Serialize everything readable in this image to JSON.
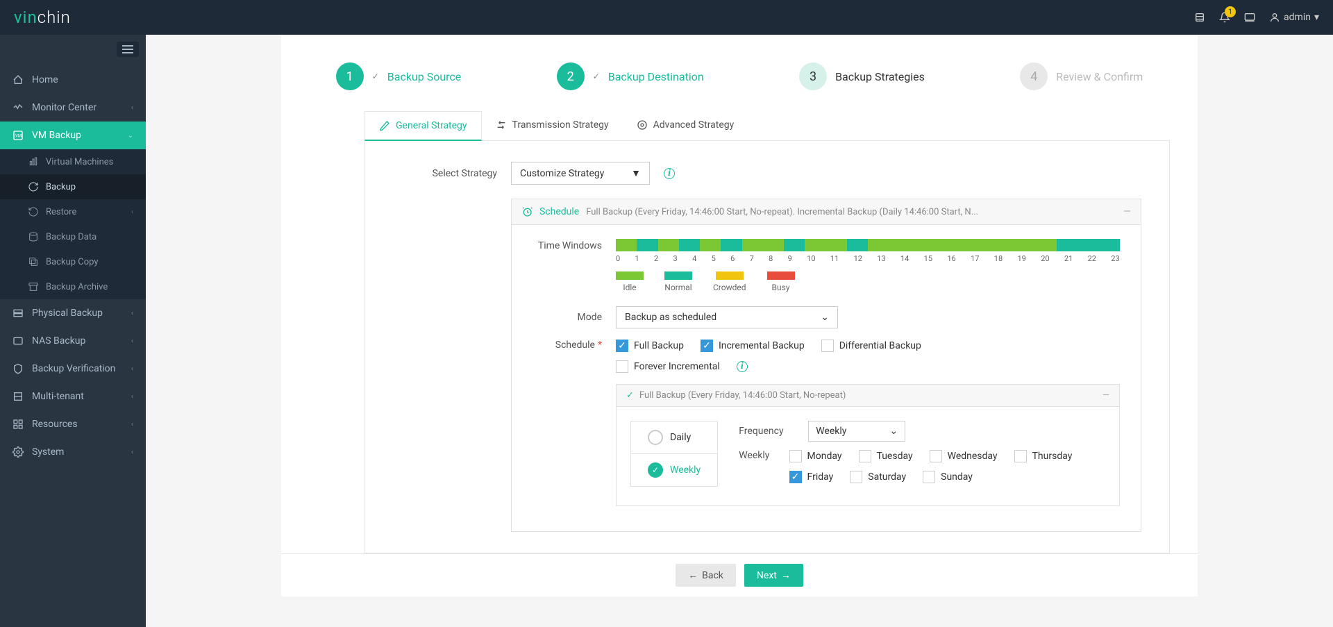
{
  "brand": {
    "prefix": "vin",
    "suffix": "chin"
  },
  "topbar": {
    "notif_count": "1",
    "user_label": "admin"
  },
  "sidebar": {
    "items": [
      {
        "label": "Home"
      },
      {
        "label": "Monitor Center"
      },
      {
        "label": "VM Backup"
      },
      {
        "label": "Physical Backup"
      },
      {
        "label": "NAS Backup"
      },
      {
        "label": "Backup Verification"
      },
      {
        "label": "Multi-tenant"
      },
      {
        "label": "Resources"
      },
      {
        "label": "System"
      }
    ],
    "vm_backup_sub": [
      {
        "label": "Virtual Machines"
      },
      {
        "label": "Backup"
      },
      {
        "label": "Restore"
      },
      {
        "label": "Backup Data"
      },
      {
        "label": "Backup Copy"
      },
      {
        "label": "Backup Archive"
      }
    ]
  },
  "wizard": {
    "steps": [
      {
        "num": "1",
        "label": "Backup Source"
      },
      {
        "num": "2",
        "label": "Backup Destination"
      },
      {
        "num": "3",
        "label": "Backup Strategies"
      },
      {
        "num": "4",
        "label": "Review & Confirm"
      }
    ]
  },
  "tabs": {
    "general": "General Strategy",
    "transmission": "Transmission Strategy",
    "advanced": "Advanced Strategy"
  },
  "form": {
    "select_strategy_label": "Select Strategy",
    "select_strategy_value": "Customize Strategy"
  },
  "schedule": {
    "title": "Schedule",
    "summary": "Full Backup (Every Friday, 14:46:00 Start, No-repeat). Incremental Backup (Daily 14:46:00 Start, N...",
    "time_windows_label": "Time Windows",
    "hours": [
      "0",
      "1",
      "2",
      "3",
      "4",
      "5",
      "6",
      "7",
      "8",
      "9",
      "10",
      "11",
      "12",
      "13",
      "14",
      "15",
      "16",
      "17",
      "18",
      "19",
      "20",
      "21",
      "22",
      "23"
    ],
    "window_colors": [
      "#7bc734",
      "#1abc9c",
      "#7bc734",
      "#1abc9c",
      "#7bc734",
      "#1abc9c",
      "#7bc734",
      "#7bc734",
      "#1abc9c",
      "#7bc734",
      "#7bc734",
      "#1abc9c",
      "#7bc734",
      "#7bc734",
      "#7bc734",
      "#7bc734",
      "#7bc734",
      "#7bc734",
      "#7bc734",
      "#7bc734",
      "#7bc734",
      "#1abc9c",
      "#1abc9c",
      "#1abc9c"
    ],
    "legend": {
      "idle": {
        "label": "Idle",
        "color": "#7bc734"
      },
      "normal": {
        "label": "Normal",
        "color": "#1abc9c"
      },
      "crowded": {
        "label": "Crowded",
        "color": "#f1c40f"
      },
      "busy": {
        "label": "Busy",
        "color": "#e74c3c"
      }
    },
    "mode_label": "Mode",
    "mode_value": "Backup as scheduled",
    "schedule_label": "Schedule",
    "options": {
      "full": "Full Backup",
      "incremental": "Incremental Backup",
      "differential": "Differential Backup",
      "forever_inc": "Forever Incremental"
    },
    "full_panel_title": "Full Backup (Every Friday, 14:46:00 Start, No-repeat)",
    "frequency_label": "Frequency",
    "frequency_value": "Weekly",
    "freq_daily": "Daily",
    "freq_weekly": "Weekly",
    "weekly_label": "Weekly",
    "days": {
      "mon": "Monday",
      "tue": "Tuesday",
      "wed": "Wednesday",
      "thu": "Thursday",
      "fri": "Friday",
      "sat": "Saturday",
      "sun": "Sunday"
    }
  },
  "buttons": {
    "back": "Back",
    "next": "Next"
  }
}
